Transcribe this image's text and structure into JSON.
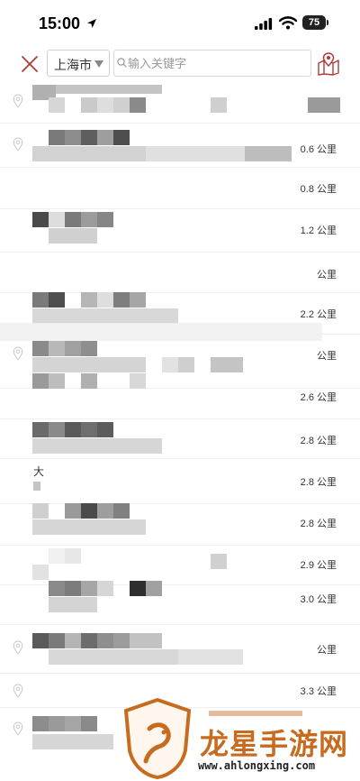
{
  "status_bar": {
    "time": "15:00",
    "battery": "75"
  },
  "search_bar": {
    "city": "上海市",
    "search_placeholder": "输入关键字"
  },
  "results": [
    {
      "distance": "",
      "fragment": "",
      "frag2": ""
    },
    {
      "distance": "0.6 公里",
      "fragment": "",
      "frag2": ""
    },
    {
      "distance": "0.8 公里",
      "fragment": "",
      "frag2": ""
    },
    {
      "distance": "1.2 公里",
      "fragment": "",
      "frag2": ""
    },
    {
      "distance": "公里",
      "fragment": "",
      "frag2": ""
    },
    {
      "distance": "2.2 公里",
      "fragment": "",
      "frag2": ""
    },
    {
      "distance": "公里",
      "fragment": "",
      "frag2": ""
    },
    {
      "distance": "2.6 公里",
      "fragment": "",
      "frag2": ""
    },
    {
      "distance": "2.8 公里",
      "fragment": "",
      "frag2": ""
    },
    {
      "distance": "2.8 公里",
      "fragment": "大",
      "frag2": ""
    },
    {
      "distance": "2.8 公里",
      "fragment": "",
      "frag2": ""
    },
    {
      "distance": "2.9 公里",
      "fragment": "",
      "frag2": ""
    },
    {
      "distance": "3.0 公里",
      "fragment": "",
      "frag2": ""
    },
    {
      "distance": "公里",
      "fragment": "",
      "frag2": ""
    },
    {
      "distance": "3.3 公里",
      "fragment": "",
      "frag2": ""
    },
    {
      "distance": "",
      "fragment": "",
      "frag2": ""
    }
  ],
  "watermark": {
    "brand": "龙星手游网",
    "url": "www.ahlongxing.com"
  },
  "colors": {
    "accent": "#b23a3a",
    "watermark": "#c76b1e",
    "blur_dark": "#5a5a5a",
    "blur_mid": "#9a9a9a",
    "blur_light": "#d4d4d4"
  }
}
